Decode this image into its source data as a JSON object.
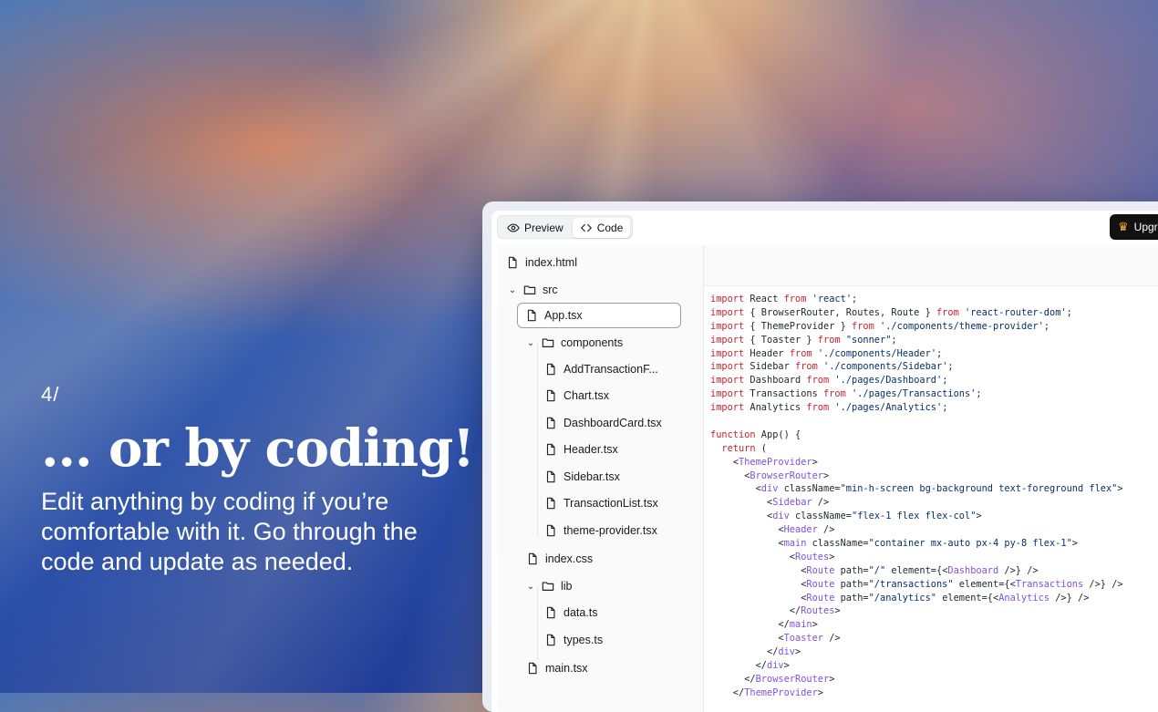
{
  "hero": {
    "step": "4/",
    "headline": "... or by coding!",
    "subtitle": "Edit anything by coding if you’re comfortable with it. Go through the code and update as needed."
  },
  "toolbar": {
    "preview_label": "Preview",
    "code_label": "Code",
    "upgrade_label": "Upgr"
  },
  "file_tree": [
    {
      "label": "index.html",
      "type": "file"
    },
    {
      "label": "src",
      "type": "folder",
      "expanded": true
    },
    {
      "label": "App.tsx",
      "type": "file",
      "selected": true
    },
    {
      "label": "components",
      "type": "folder",
      "expanded": true
    },
    {
      "label": "AddTransactionF...",
      "type": "file"
    },
    {
      "label": "Chart.tsx",
      "type": "file"
    },
    {
      "label": "DashboardCard.tsx",
      "type": "file"
    },
    {
      "label": "Header.tsx",
      "type": "file"
    },
    {
      "label": "Sidebar.tsx",
      "type": "file"
    },
    {
      "label": "TransactionList.tsx",
      "type": "file"
    },
    {
      "label": "theme-provider.tsx",
      "type": "file"
    },
    {
      "label": "index.css",
      "type": "file"
    },
    {
      "label": "lib",
      "type": "folder",
      "expanded": true
    },
    {
      "label": "data.ts",
      "type": "file"
    },
    {
      "label": "types.ts",
      "type": "file"
    },
    {
      "label": "main.tsx",
      "type": "file"
    }
  ],
  "code_lines": [
    "import React from 'react';",
    "import { BrowserRouter, Routes, Route } from 'react-router-dom';",
    "import { ThemeProvider } from './components/theme-provider';",
    "import { Toaster } from \"sonner\";",
    "import Header from './components/Header';",
    "import Sidebar from './components/Sidebar';",
    "import Dashboard from './pages/Dashboard';",
    "import Transactions from './pages/Transactions';",
    "import Analytics from './pages/Analytics';",
    "",
    "function App() {",
    "  return (",
    "    <ThemeProvider>",
    "      <BrowserRouter>",
    "        <div className=\"min-h-screen bg-background text-foreground flex\">",
    "          <Sidebar />",
    "          <div className=\"flex-1 flex flex-col\">",
    "            <Header />",
    "            <main className=\"container mx-auto px-4 py-8 flex-1\">",
    "              <Routes>",
    "                <Route path=\"/\" element={<Dashboard />} />",
    "                <Route path=\"/transactions\" element={<Transactions />} />",
    "                <Route path=\"/analytics\" element={<Analytics />} />",
    "              </Routes>",
    "            </main>",
    "            <Toaster />",
    "          </div>",
    "        </div>",
    "      </BrowserRouter>",
    "    </ThemeProvider>"
  ],
  "colors": {
    "keyword": "#cf222e",
    "string": "#0a3069",
    "tag": "#8250df",
    "crown": "#f5b73b"
  },
  "icons": {
    "preview": "eye-icon",
    "code": "code-icon",
    "upgrade": "crown-icon",
    "file": "file-icon",
    "folder": "folder-icon",
    "chevron": "chevron-down-icon"
  }
}
